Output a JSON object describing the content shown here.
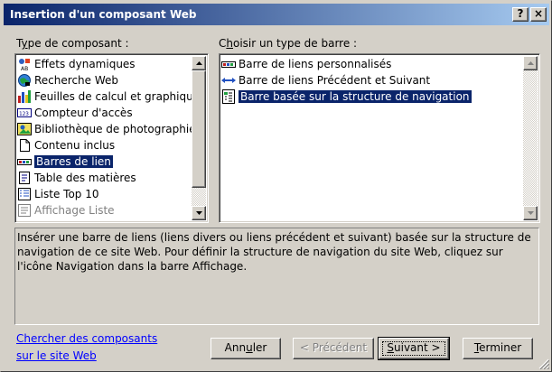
{
  "window": {
    "title": "Insertion d'un composant Web",
    "help_label": "?",
    "close_label": "×"
  },
  "left_panel": {
    "label_pre": "T",
    "label_key": "y",
    "label_post": "pe de composant :",
    "items": [
      {
        "label": "Effets dynamiques",
        "icon": "effects-icon"
      },
      {
        "label": "Recherche Web",
        "icon": "globe-search-icon"
      },
      {
        "label": "Feuilles de calcul et graphique",
        "icon": "spreadsheet-chart-icon"
      },
      {
        "label": "Compteur d'accès",
        "icon": "counter-icon"
      },
      {
        "label": "Bibliothèque de photographie",
        "icon": "photo-icon"
      },
      {
        "label": "Contenu inclus",
        "icon": "document-icon"
      },
      {
        "label": "Barres de lien",
        "icon": "link-bar-icon",
        "selected": true
      },
      {
        "label": "Table des matières",
        "icon": "toc-icon"
      },
      {
        "label": "Liste Top 10",
        "icon": "list-icon"
      },
      {
        "label": "Affichage Liste",
        "icon": "list-view-icon",
        "dimmed": true
      }
    ]
  },
  "right_panel": {
    "label_pre": "C",
    "label_key": "h",
    "label_post": "oisir un type de barre :",
    "items": [
      {
        "label": "Barre de liens personnalisés",
        "icon": "custom-link-bar-icon"
      },
      {
        "label": "Barre de liens Précédent et Suivant",
        "icon": "prev-next-arrows-icon"
      },
      {
        "label": "Barre basée sur la structure de navigation",
        "icon": "navigation-structure-icon",
        "selected": true
      }
    ]
  },
  "description": "Insérer une barre de liens (liens divers ou liens précédent et suivant) basée sur la structure de navigation de ce site Web. Pour définir la structure de navigation du site Web, cliquez sur l'icône Navigation dans la barre Affichage.",
  "link": {
    "line1": "Chercher des composants",
    "line2": "sur le site Web"
  },
  "buttons": {
    "cancel_pre": "Ann",
    "cancel_key": "u",
    "cancel_post": "ler",
    "previous": "< Précédent",
    "next_pre": "",
    "next_key": "S",
    "next_post": "uivant >",
    "finish_pre": "",
    "finish_key": "T",
    "finish_post": "erminer"
  },
  "colors": {
    "selection": "#0a246a",
    "title_gradient_start": "#0a246a",
    "title_gradient_end": "#a6caf0",
    "face": "#d4d0c8",
    "link": "#0000ff"
  }
}
